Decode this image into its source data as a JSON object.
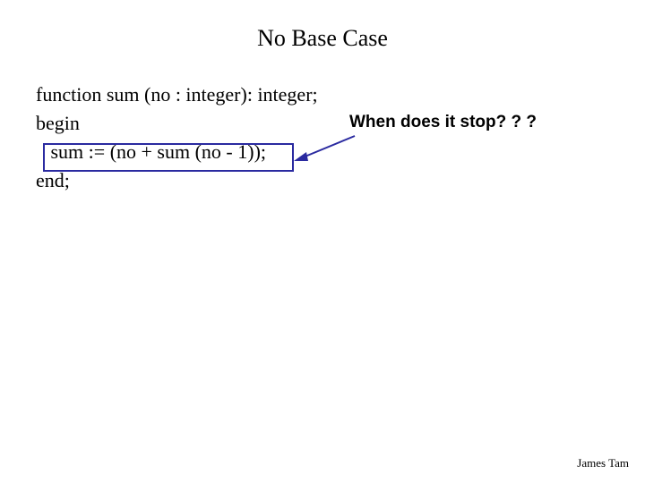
{
  "title": "No Base Case",
  "code": {
    "line1": "function sum (no : integer): integer;",
    "line2": "begin",
    "line3": "   sum := (no + sum (no - 1));",
    "line4": "end;"
  },
  "annotation": "When does it stop? ? ?",
  "footer": "James Tam"
}
